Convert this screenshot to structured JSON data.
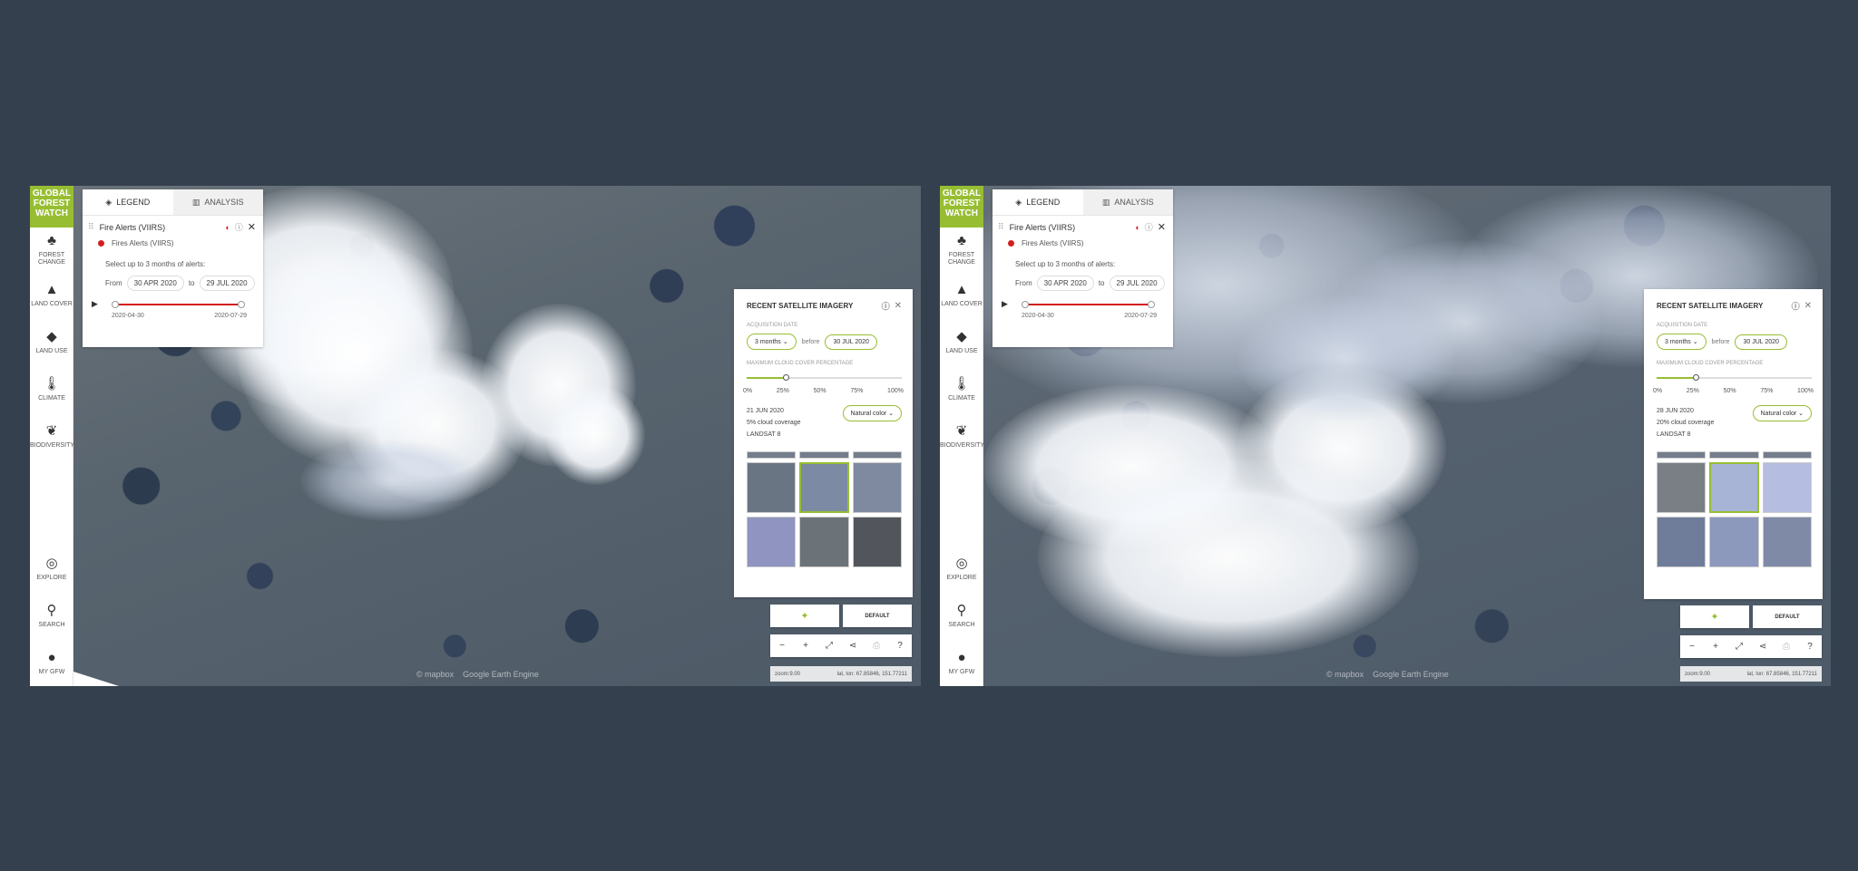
{
  "colors": {
    "brand": "#97be32",
    "fire": "#d31e1e",
    "background": "#35404e"
  },
  "sidebar": {
    "logo": [
      "GLOBAL",
      "FOREST",
      "WATCH"
    ],
    "items": [
      {
        "label": "FOREST CHANGE",
        "icon": "tree-icon"
      },
      {
        "label": "LAND COVER",
        "icon": "mountain-icon"
      },
      {
        "label": "LAND USE",
        "icon": "layers-icon"
      },
      {
        "label": "CLIMATE",
        "icon": "thermometer-icon"
      },
      {
        "label": "BIODIVERSITY",
        "icon": "paw-icon"
      }
    ],
    "bottom": [
      {
        "label": "EXPLORE",
        "icon": "compass-icon"
      },
      {
        "label": "SEARCH",
        "icon": "search-icon"
      },
      {
        "label": "MY GFW",
        "icon": "user-icon"
      }
    ]
  },
  "legend": {
    "tab_legend": "LEGEND",
    "tab_analysis": "ANALYSIS",
    "layer_title": "Fire Alerts (VIIRS)",
    "sublayer": "Fires Alerts (VIIRS)",
    "note": "Select up to 3 months of alerts:",
    "from_label": "From",
    "to_label": "to",
    "from_date": "30 APR 2020",
    "to_date": "29 JUL 2020",
    "range_start": "2020-04-30",
    "range_end": "2020-07-29"
  },
  "satellite": {
    "title": "RECENT SATELLITE IMAGERY",
    "acq_label": "ACQUISITION DATE",
    "period": "3 months",
    "before_label": "before",
    "before_date": "30 JUL 2020",
    "cloud_label": "MAXIMUM CLOUD COVER PERCENTAGE",
    "cloud_value_pct": 25,
    "ticks": [
      "0%",
      "25%",
      "50%",
      "75%",
      "100%"
    ],
    "render_option": "Natural color"
  },
  "panels": [
    {
      "scene_date": "21 JUN 2020",
      "cloud_coverage": "5% cloud coverage",
      "sensor": "LANDSAT 8"
    },
    {
      "scene_date": "28 JUN 2020",
      "cloud_coverage": "20% cloud coverage",
      "sensor": "LANDSAT 8"
    }
  ],
  "basemap": {
    "default_label": "DEFAULT"
  },
  "footer": {
    "zoom": "zoom:9.00",
    "latlon": "lat, lon: 67.85846, 151.77211"
  },
  "attribution": {
    "mapbox": "© mapbox",
    "google": "Google Earth Engine"
  }
}
